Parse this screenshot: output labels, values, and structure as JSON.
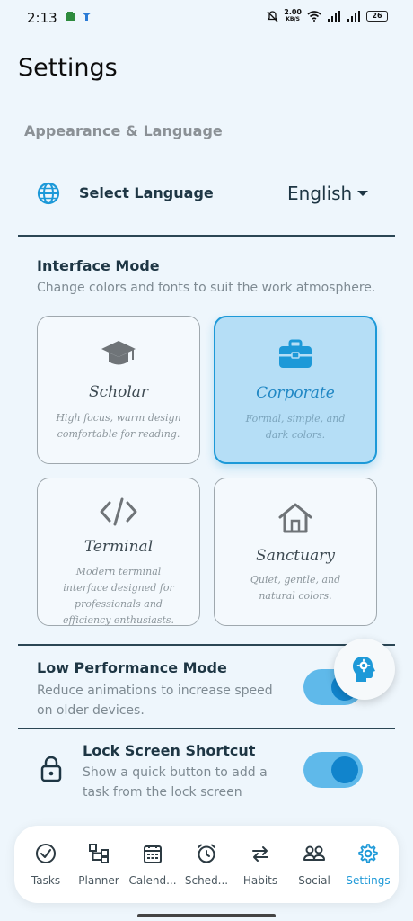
{
  "status": {
    "time": "2:13",
    "net_speed_value": "2.00",
    "net_speed_unit": "KB/S",
    "battery": "26"
  },
  "page": {
    "title": "Settings",
    "section_title": "Appearance & Language"
  },
  "language": {
    "label": "Select Language",
    "value": "English",
    "icon": "globe-icon"
  },
  "interface_mode": {
    "heading": "Interface Mode",
    "description": "Change colors and fonts to suit the work atmosphere.",
    "selected": "Corporate",
    "cards": [
      {
        "name": "Scholar",
        "desc": "High focus, warm design comfortable for reading.",
        "icon": "graduation-cap-icon"
      },
      {
        "name": "Corporate",
        "desc": "Formal, simple, and dark colors.",
        "icon": "briefcase-icon"
      },
      {
        "name": "Terminal",
        "desc": "Modern terminal interface designed for professionals and efficiency enthusiasts.",
        "icon": "code-icon"
      },
      {
        "name": "Sanctuary",
        "desc": "Quiet, gentle, and natural colors.",
        "icon": "home-icon"
      }
    ]
  },
  "low_performance": {
    "title": "Low Performance Mode",
    "description": "Reduce animations to increase speed on older devices.",
    "enabled": true
  },
  "lock_screen": {
    "title": "Lock Screen Shortcut",
    "description": "Show a quick button to add a task from the lock screen",
    "enabled": true,
    "icon": "lock-icon"
  },
  "nav": {
    "active": "Settings",
    "items": [
      {
        "label": "Tasks",
        "icon": "check-circle-icon"
      },
      {
        "label": "Planner",
        "icon": "flowchart-icon"
      },
      {
        "label": "Calend...",
        "icon": "calendar-icon"
      },
      {
        "label": "Sched...",
        "icon": "alarm-clock-icon"
      },
      {
        "label": "Habits",
        "icon": "repeat-icon"
      },
      {
        "label": "Social",
        "icon": "people-icon"
      },
      {
        "label": "Settings",
        "icon": "gear-icon"
      }
    ]
  },
  "colors": {
    "accent": "#1d99d8",
    "background": "#eef6fc",
    "selected_card": "#b5def6",
    "toggle_track": "#5fb9ea",
    "toggle_knob": "#1184cc"
  }
}
